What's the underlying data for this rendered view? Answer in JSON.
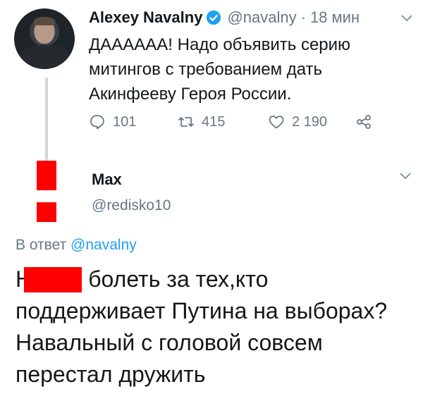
{
  "tweet": {
    "author_name": "Alexey Navalny",
    "verified_icon": "verified-badge-icon",
    "handle": "@navalny",
    "separator": "·",
    "time": "18 мин",
    "text": "ДАААААА! Надо объявить серию митингов с требованием дать Акинфееву Героя России.",
    "actions": {
      "reply_count": "101",
      "retweet_count": "415",
      "like_count": "2 190"
    }
  },
  "reply": {
    "author_name": "Max",
    "handle": "@redisko10",
    "reply_to_prefix": "В ответ",
    "reply_to_handle": "@navalny",
    "text": "Н      й болеть за тех,кто поддерживает Путина на выборах? Навальный с головой совсем перестал дружить"
  },
  "colors": {
    "accent": "#1da1f2",
    "muted": "#657786",
    "censor": "#ff0000"
  }
}
